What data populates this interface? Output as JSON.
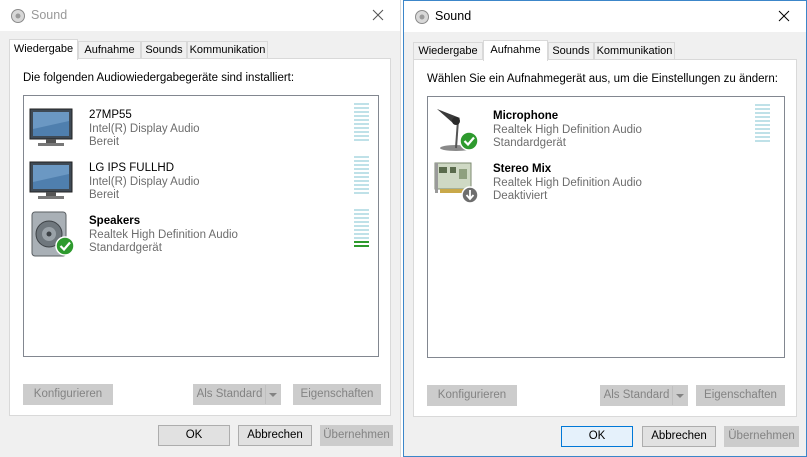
{
  "left_dialog": {
    "title": "Sound",
    "tabs": [
      {
        "label": "Wiedergabe",
        "active": true
      },
      {
        "label": "Aufnahme",
        "active": false
      },
      {
        "label": "Sounds",
        "active": false
      },
      {
        "label": "Kommunikation",
        "active": false
      }
    ],
    "description": "Die folgenden Audiowiedergabegeräte sind installiert:",
    "devices": [
      {
        "name": "27MP55",
        "driver": "Intel(R) Display Audio",
        "status": "Bereit",
        "icon": "monitor-icon",
        "level": 0
      },
      {
        "name": "LG IPS FULLHD",
        "driver": "Intel(R) Display Audio",
        "status": "Bereit",
        "icon": "monitor-icon",
        "level": 0
      },
      {
        "name": "Speakers",
        "driver": "Realtek High Definition Audio",
        "status": "Standardgerät",
        "icon": "speaker-icon",
        "level": 0.15,
        "default": true
      }
    ],
    "buttons": {
      "configure": "Konfigurieren",
      "set_default": "Als Standard",
      "properties": "Eigenschaften"
    },
    "footer": {
      "ok": "OK",
      "cancel": "Abbrechen",
      "apply": "Übernehmen"
    }
  },
  "right_dialog": {
    "title": "Sound",
    "tabs": [
      {
        "label": "Wiedergabe",
        "active": false
      },
      {
        "label": "Aufnahme",
        "active": true
      },
      {
        "label": "Sounds",
        "active": false
      },
      {
        "label": "Kommunikation",
        "active": false
      }
    ],
    "description": "Wählen Sie ein Aufnahmegerät aus, um die Einstellungen zu ändern:",
    "devices": [
      {
        "name": "Microphone",
        "driver": "Realtek High Definition Audio",
        "status": "Standardgerät",
        "icon": "microphone-icon",
        "level": 0,
        "default": true
      },
      {
        "name": "Stereo Mix",
        "driver": "Realtek High Definition Audio",
        "status": "Deaktiviert",
        "icon": "sound-card-icon",
        "disabled": true
      }
    ],
    "buttons": {
      "configure": "Konfigurieren",
      "set_default": "Als Standard",
      "properties": "Eigenschaften"
    },
    "footer": {
      "ok": "OK",
      "cancel": "Abbrechen",
      "apply": "Übernehmen"
    }
  },
  "colors": {
    "accent": "#0078d7",
    "meter_idle": "#bfe1e8",
    "meter_active": "#2e9a2e",
    "window_border": "#3c86c9"
  }
}
